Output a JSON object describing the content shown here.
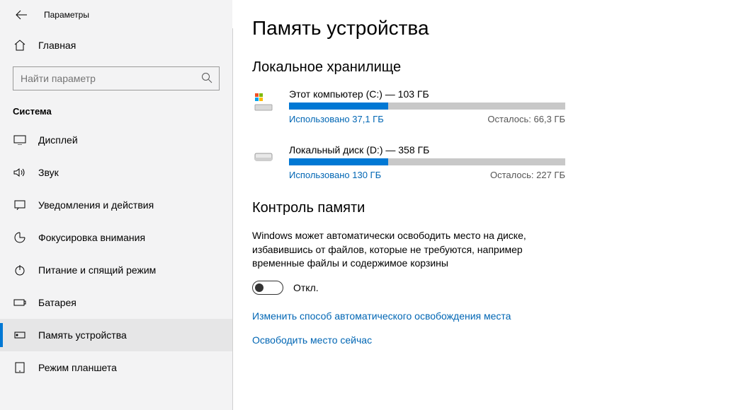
{
  "window": {
    "title": "Параметры"
  },
  "home": {
    "label": "Главная"
  },
  "search": {
    "placeholder": "Найти параметр"
  },
  "group": {
    "label": "Система"
  },
  "nav": {
    "items": [
      {
        "label": "Дисплей"
      },
      {
        "label": "Звук"
      },
      {
        "label": "Уведомления и действия"
      },
      {
        "label": "Фокусировка внимания"
      },
      {
        "label": "Питание и спящий режим"
      },
      {
        "label": "Батарея"
      },
      {
        "label": "Память устройства"
      },
      {
        "label": "Режим планшета"
      }
    ]
  },
  "page": {
    "title": "Память устройства",
    "storage_heading": "Локальное хранилище",
    "drives": [
      {
        "title": "Этот компьютер (C:) — 103 ГБ",
        "used": "Использовано 37,1 ГБ",
        "remain": "Осталось: 66,3 ГБ",
        "fill_percent": 36
      },
      {
        "title": "Локальный диск (D:) — 358 ГБ",
        "used": "Использовано 130 ГБ",
        "remain": "Осталось: 227 ГБ",
        "fill_percent": 36
      }
    ],
    "sense_heading": "Контроль памяти",
    "sense_desc": "Windows может автоматически освободить место на диске, избавившись от файлов, которые не требуются, например временные файлы и содержимое корзины",
    "toggle_label": "Откл.",
    "link1": "Изменить способ автоматического освобождения места",
    "link2": "Освободить место сейчас"
  }
}
